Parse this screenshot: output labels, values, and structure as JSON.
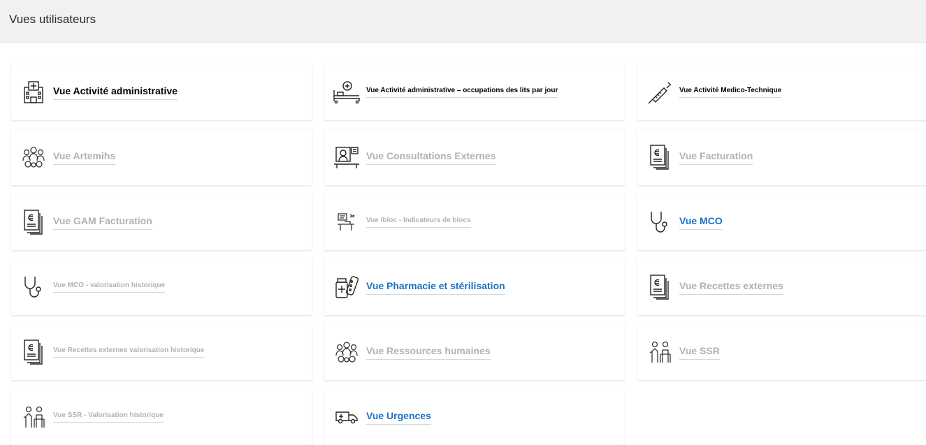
{
  "header": {
    "title": "Vues utilisateurs"
  },
  "colors": {
    "active": "#1a73c8",
    "disabled": "#b1b1b1",
    "header_bg": "#f1f1f1"
  },
  "cards": [
    {
      "label": "Vue Activité administrative",
      "icon": "hospital-building-icon",
      "state": "active"
    },
    {
      "label": "Vue Activité administrative – occupations des lits par jour",
      "icon": "hospital-bed-icon",
      "state": "active"
    },
    {
      "label": "Vue Activité Medico-Technique",
      "icon": "syringe-icon",
      "state": "active"
    },
    {
      "label": "Vue Artemihs",
      "icon": "people-gears-icon",
      "state": "disabled"
    },
    {
      "label": "Vue Consultations Externes",
      "icon": "doctor-consultation-icon",
      "state": "disabled"
    },
    {
      "label": "Vue Facturation",
      "icon": "euro-invoice-icon",
      "state": "disabled"
    },
    {
      "label": "Vue GAM Facturation",
      "icon": "euro-invoice-icon",
      "state": "disabled"
    },
    {
      "label": "Vue Ibloc - Indicateurs de blocs",
      "icon": "operating-room-icon",
      "state": "disabled"
    },
    {
      "label": "Vue MCO",
      "icon": "stethoscope-icon",
      "state": "active"
    },
    {
      "label": "Vue MCO - valorisation historique",
      "icon": "stethoscope-icon",
      "state": "disabled"
    },
    {
      "label": "Vue Pharmacie et stérilisation",
      "icon": "pharmacy-pills-icon",
      "state": "active"
    },
    {
      "label": "Vue Recettes externes",
      "icon": "euro-invoice-icon",
      "state": "disabled"
    },
    {
      "label": "Vue Recettes externes valorisation historique",
      "icon": "euro-invoice-icon",
      "state": "disabled"
    },
    {
      "label": "Vue Ressources humaines",
      "icon": "people-gears-icon",
      "state": "disabled"
    },
    {
      "label": "Vue SSR",
      "icon": "elderly-rehab-icon",
      "state": "disabled"
    },
    {
      "label": "Vue SSR - Valorisation historique",
      "icon": "elderly-rehab-icon",
      "state": "disabled"
    },
    {
      "label": "Vue Urgences",
      "icon": "ambulance-icon",
      "state": "active"
    }
  ]
}
